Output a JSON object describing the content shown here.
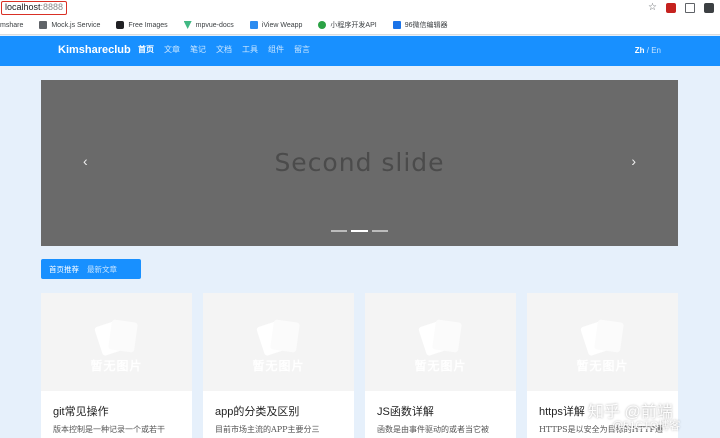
{
  "browser": {
    "url_host": "localhost",
    "url_port": ":8888",
    "bookmarks": [
      {
        "label": "mshare",
        "icon": "none"
      },
      {
        "label": "Mock.js Service",
        "icon": "doc-icon"
      },
      {
        "label": "Free Images",
        "icon": "camera-icon"
      },
      {
        "label": "mpvue-docs",
        "icon": "vue-icon"
      },
      {
        "label": "iView Weapp",
        "icon": "iview-icon"
      },
      {
        "label": "小程序开发API",
        "icon": "wechat-icon"
      },
      {
        "label": "96微信编辑器",
        "icon": "editor-icon"
      }
    ]
  },
  "navbar": {
    "brand": "Kimshareclub",
    "items": [
      "首页",
      "文章",
      "笔记",
      "文档",
      "工具",
      "组件",
      "留言"
    ],
    "lang_current": "Zh",
    "lang_sep": " / ",
    "lang_other": "En"
  },
  "carousel": {
    "slide_text": "Second slide",
    "prev": "‹",
    "next": "›",
    "indicator_count": 3,
    "active_index": 1
  },
  "tabs": {
    "items": [
      "首页推荐",
      "最新文章"
    ]
  },
  "cards": [
    {
      "placeholder": "暂无图片",
      "title": "git常见操作",
      "desc": "版本控制是一种记录一个或若干"
    },
    {
      "placeholder": "暂无图片",
      "title": "app的分类及区别",
      "desc": "目前市场主流的APP主要分三"
    },
    {
      "placeholder": "暂无图片",
      "title": "JS函数详解",
      "desc": "函数是由事件驱动的或者当它被"
    },
    {
      "placeholder": "暂无图片",
      "title": "https详解",
      "desc": "HTTPS是以安全为目标的HTTP通"
    }
  ],
  "watermark": {
    "line1": "知乎 @前端",
    "line2": "@51CTO博客"
  }
}
